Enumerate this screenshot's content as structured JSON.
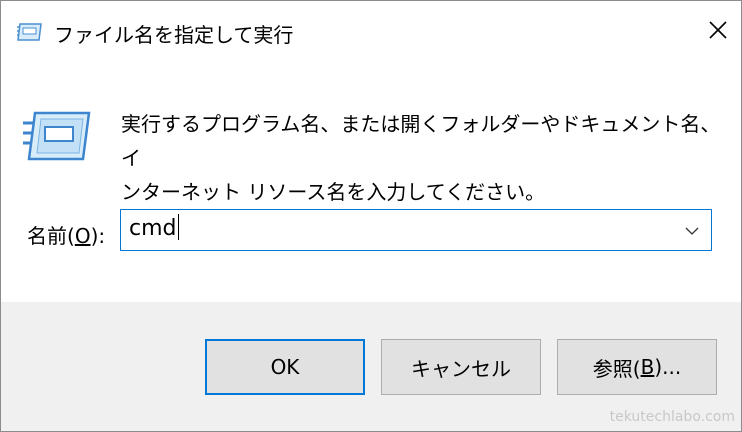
{
  "window": {
    "title": "ファイル名を指定して実行",
    "close_glyph": "✕"
  },
  "dialog": {
    "description_line1": "実行するプログラム名、または開くフォルダーやドキュメント名、イ",
    "description_line2": "ンターネット リソース名を入力してください。",
    "name_label_pre": "名前(",
    "name_label_key": "O",
    "name_label_post": "):",
    "name_value": "cmd"
  },
  "buttons": {
    "ok_label": "OK",
    "cancel_label": "キャンセル",
    "browse_label_pre": "参照(",
    "browse_label_key": "B",
    "browse_label_post": ")..."
  },
  "watermark": "tekutechlabo.com",
  "icons": {
    "title": "run-app-icon",
    "dialog": "run-app-icon",
    "close": "close-icon",
    "dropdown": "chevron-down-icon"
  },
  "colors": {
    "accent": "#0078d7",
    "footer_bg": "#f0f0f0",
    "button_bg": "#e1e1e1",
    "button_border": "#adadad"
  }
}
